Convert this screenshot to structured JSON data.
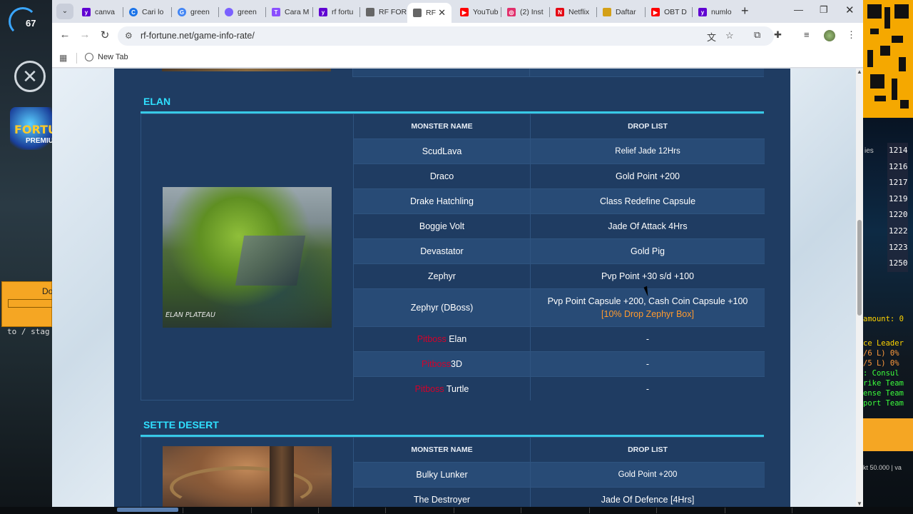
{
  "left_overlay": {
    "hud_number": "67",
    "logo_text": "FORTU",
    "logo_sub": "PREMIU",
    "box_label": "Do",
    "bottom_text": "to / stag"
  },
  "right_overlay": {
    "list_numbers": [
      "1214",
      "1216",
      "1217",
      "1219",
      "1220",
      "1222",
      "1223",
      "1250"
    ],
    "chat_lines": [
      "amount: 0",
      "ce Leader",
      "/6 L) 0%",
      "/5 L) 0%",
      ": Consul",
      "rike Team",
      "ense Team",
      "port Team"
    ],
    "footer": "kt 50.000 | va",
    "side_label": "ies"
  },
  "browser": {
    "tabs": [
      {
        "label": "canva",
        "icon": "yahoo-icon",
        "color": "#6001d2"
      },
      {
        "label": "Cari lo",
        "icon": "chrome-icon",
        "color": "#1a73e8"
      },
      {
        "label": "green",
        "icon": "google-icon",
        "color": "#4285f4"
      },
      {
        "label": "green",
        "icon": "copilot-icon",
        "color": "#7b61ff"
      },
      {
        "label": "Cara M",
        "icon": "tutorial-icon",
        "color": "#8a4fff"
      },
      {
        "label": "rf fortu",
        "icon": "yahoo-icon",
        "color": "#6001d2"
      },
      {
        "label": "RF FOR",
        "icon": "rf-icon",
        "color": "#666666"
      },
      {
        "label": "RF",
        "icon": "rf-icon",
        "color": "#666666"
      },
      {
        "label": "YouTub",
        "icon": "youtube-icon",
        "color": "#ff0000"
      },
      {
        "label": "(2) Inst",
        "icon": "instagram-icon",
        "color": "#e1306c"
      },
      {
        "label": "Netflix",
        "icon": "netflix-icon",
        "color": "#e50914"
      },
      {
        "label": "Daftar",
        "icon": "daftar-icon",
        "color": "#d4a017"
      },
      {
        "label": "OBT D",
        "icon": "youtube-icon",
        "color": "#ff0000"
      },
      {
        "label": "numlo",
        "icon": "yahoo-icon",
        "color": "#6001d2"
      }
    ],
    "active_tab_index": 7,
    "url": "rf-fortune.net/game-info-rate/",
    "bookmark": "New Tab"
  },
  "page": {
    "sections": [
      {
        "title": "ELAN",
        "image_caption": "ELAN PLATEAU",
        "header": {
          "monster": "MONSTER NAME",
          "drop": "DROP LIST"
        },
        "rows": [
          {
            "monster": "ScudLava",
            "drop": "Relief Jade 12Hrs"
          },
          {
            "monster": "Draco",
            "drop": "Gold Point +200"
          },
          {
            "monster": "Drake Hatchling",
            "drop": "Class Redefine Capsule"
          },
          {
            "monster": "Boggie Volt",
            "drop": "Jade Of Attack 4Hrs"
          },
          {
            "monster": "Devastator",
            "drop": "Gold Pig"
          },
          {
            "monster": "Zephyr",
            "drop": "Pvp Point +30 s/d +100"
          },
          {
            "monster": "Zephyr (DBoss)",
            "drop": "Pvp Point Capsule +200, Cash Coin Capsule +100 ",
            "drop_highlight": "[10% Drop Zephyr Box]"
          },
          {
            "monster_prefix": "Pitboss",
            "monster": " Elan",
            "drop": "-"
          },
          {
            "monster_prefix": "Pitboss",
            "monster": " 3D",
            "drop": "-"
          },
          {
            "monster_prefix": "Pitboss",
            "monster": " Turtle",
            "drop": "-"
          }
        ]
      },
      {
        "title": "SETTE DESERT",
        "header": {
          "monster": "MONSTER NAME",
          "drop": "DROP LIST"
        },
        "rows": [
          {
            "monster": "Bulky Lunker",
            "drop": "Gold Point +200"
          },
          {
            "monster": "The Destroyer",
            "drop": "Jade Of Defence [4Hrs]"
          }
        ]
      }
    ],
    "top_remnant_drop": "g"
  }
}
